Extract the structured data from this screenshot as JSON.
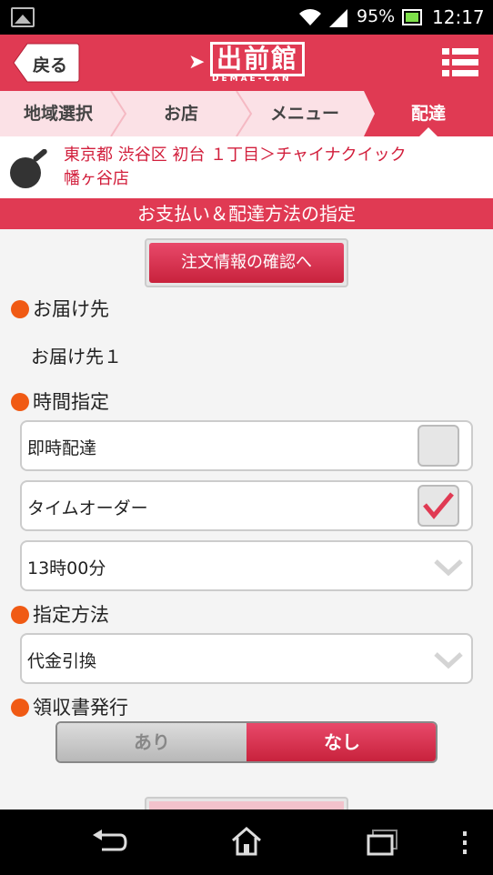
{
  "status_bar": {
    "battery_percent": "95%",
    "time": "12:17"
  },
  "header": {
    "back_label": "戻る",
    "logo_text": "出前館",
    "logo_sub": "DEMAE-CAN"
  },
  "steps": [
    {
      "label": "地域選択",
      "active": false
    },
    {
      "label": "お店",
      "active": false
    },
    {
      "label": "メニュー",
      "active": false
    },
    {
      "label": "配達",
      "active": true
    }
  ],
  "shop": {
    "line1": "東京都 渋谷区 初台 １丁目＞チャイナクイック",
    "line2": "幡ヶ谷店"
  },
  "section_title": "お支払い＆配達方法の指定",
  "confirm_button_label": "注文情報の確認へ",
  "delivery_to": {
    "label": "お届け先",
    "value": "お届け先１"
  },
  "time_spec": {
    "label": "時間指定",
    "options": [
      {
        "label": "即時配達",
        "checked": false
      },
      {
        "label": "タイムオーダー",
        "checked": true
      }
    ],
    "selected_time": "13時00分"
  },
  "payment": {
    "label": "指定方法",
    "selected": "代金引換"
  },
  "receipt": {
    "label": "領収書発行",
    "yes_label": "あり",
    "no_label": "なし",
    "selected": "なし"
  },
  "colors": {
    "brand_red": "#e03a53",
    "dot_orange": "#f05a14",
    "shop_text_red": "#d21f3c"
  }
}
